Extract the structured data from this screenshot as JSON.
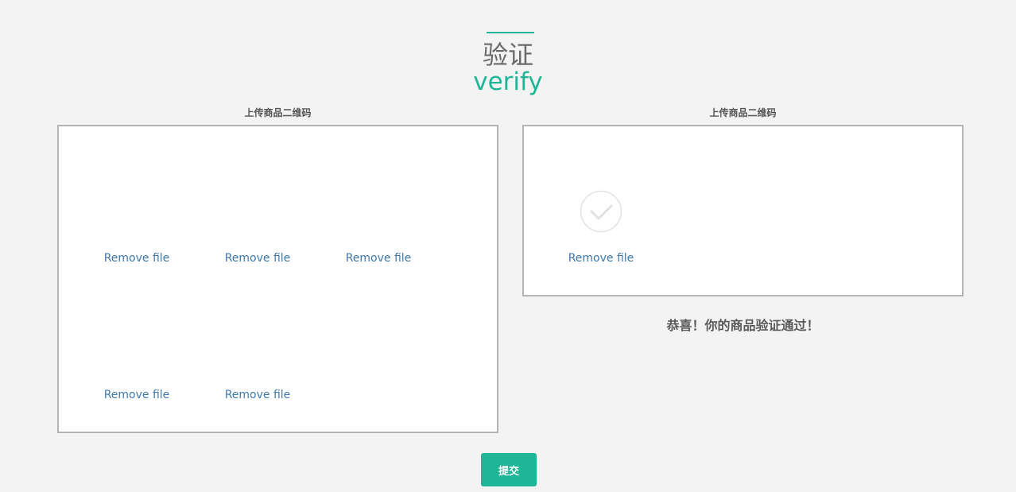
{
  "colors": {
    "accent": "#1fb597",
    "link": "#3f79aa",
    "background": "#f3f3f3",
    "border": "#b4b4b4"
  },
  "header": {
    "title_cn": "验证",
    "title_en": "verify"
  },
  "left_panel": {
    "label": "上传商品二维码",
    "files": [
      {
        "remove_label": "Remove file"
      },
      {
        "remove_label": "Remove file"
      },
      {
        "remove_label": "Remove file"
      },
      {
        "remove_label": "Remove file"
      },
      {
        "remove_label": "Remove file"
      }
    ]
  },
  "right_panel": {
    "label": "上传商品二维码",
    "file": {
      "status_icon": "check-circle-icon",
      "remove_label": "Remove file"
    },
    "success_message": "恭喜！你的商品验证通过！"
  },
  "submit_button": {
    "label": "提交"
  }
}
